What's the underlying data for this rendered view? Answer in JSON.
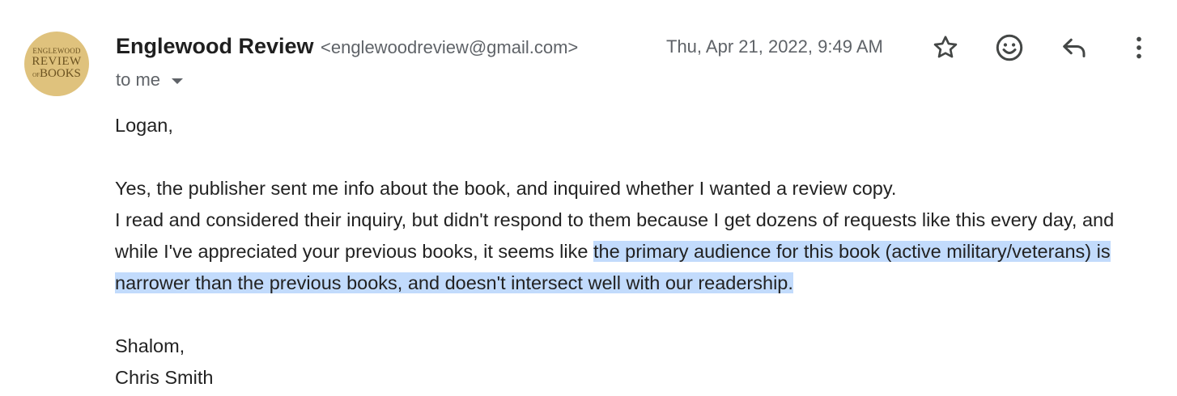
{
  "avatar": {
    "line1": "ENGLEWOOD",
    "line2": "REVIEW",
    "line3_prefix": "OF",
    "line3": "BOOKS",
    "color": "#dfc27d"
  },
  "header": {
    "sender_name": "Englewood Review",
    "sender_email": "<englewoodreview@gmail.com>",
    "recipient": "to me",
    "date": "Thu, Apr 21, 2022, 9:49 AM"
  },
  "actions": {
    "star_icon": "star-icon",
    "emoji_icon": "emoji-icon",
    "reply_icon": "reply-icon",
    "more_icon": "more-vert-icon"
  },
  "message": {
    "greeting": "Logan,",
    "line1": "Yes, the publisher sent me info about the book, and inquired whether I wanted a review copy.",
    "line2_plain": "I read and considered their inquiry, but didn't respond to them because I get dozens of requests like this every day, and while I've appreciated your previous books, it seems like ",
    "line2_highlighted": "the primary audience for this book (active military/veterans) is narrower than the previous books, and doesn't intersect well with our readership.",
    "closing": "Shalom,",
    "signature": "Chris Smith"
  },
  "colors": {
    "highlight": "#c2dbfc",
    "muted_text": "#5f6368",
    "body_text": "#222222"
  }
}
